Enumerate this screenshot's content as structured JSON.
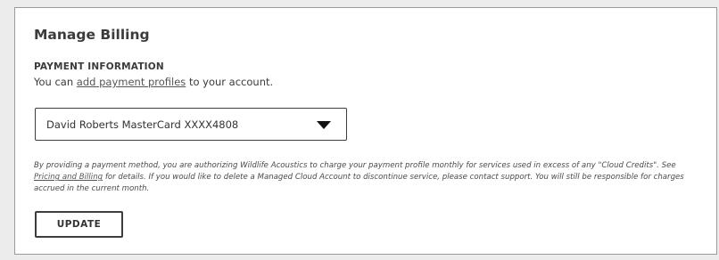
{
  "billing": {
    "title": "Manage Billing",
    "section_label": "PAYMENT INFORMATION",
    "info_prefix": "You can ",
    "info_link": "add payment profiles",
    "info_suffix": " to your account.",
    "selected_profile": "David Roberts MasterCard XXXX4808",
    "dropdown_icon": "caret-down-icon",
    "disclaimer_part1": "By providing a payment method, you are authorizing Wildlife Acoustics to charge your payment profile monthly for services used in excess of any \"Cloud Credits\". See ",
    "disclaimer_link": "Pricing and Billing",
    "disclaimer_part2": " for details. If you would like to delete a Managed Cloud Account to discontinue service, please contact support. You will still be responsible for charges accrued in the current month.",
    "update_label": "UPDATE"
  }
}
